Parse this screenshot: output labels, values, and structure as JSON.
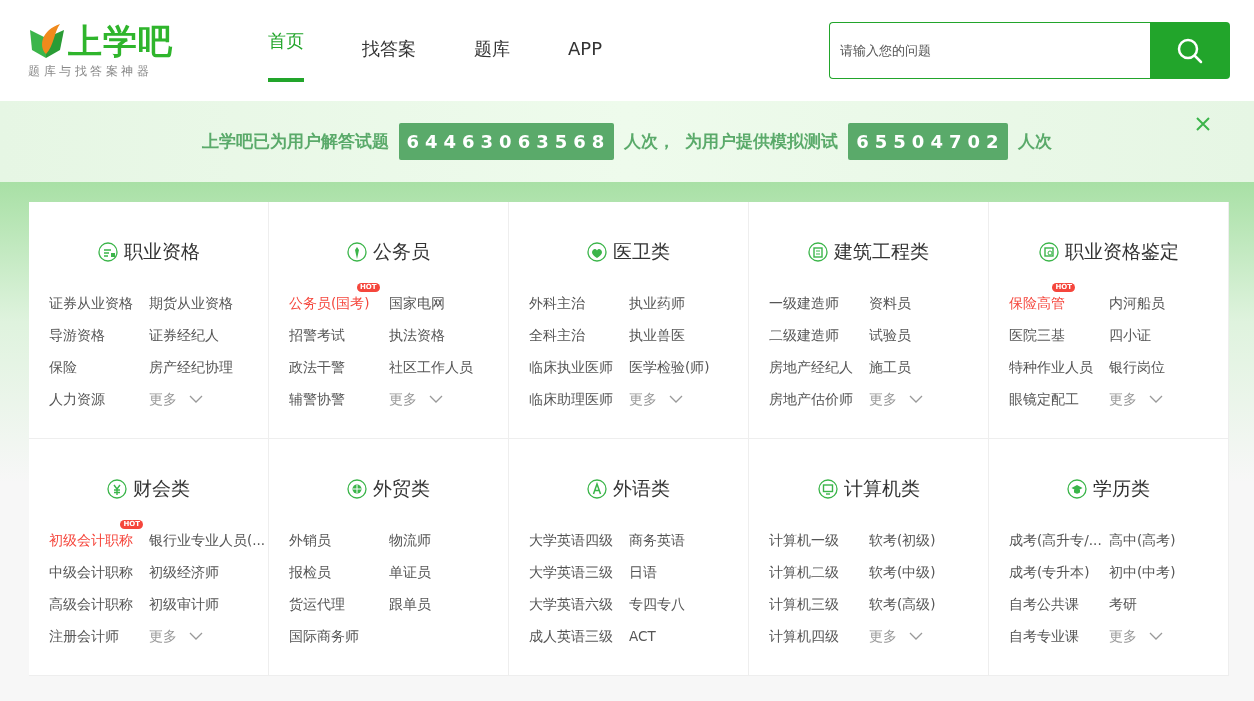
{
  "logo": {
    "name": "上学吧",
    "tagline": "题库与找答案神器"
  },
  "nav": [
    {
      "label": "首页",
      "selected": true
    },
    {
      "label": "找答案",
      "selected": false
    },
    {
      "label": "题库",
      "selected": false
    },
    {
      "label": "APP",
      "selected": false
    }
  ],
  "search": {
    "placeholder": "请输入您的问题"
  },
  "banner": {
    "parts": [
      {
        "kind": "text",
        "text": "上学吧已为用户解答试题"
      },
      {
        "kind": "counter",
        "text": "64463063568"
      },
      {
        "kind": "text",
        "text": "人次，"
      },
      {
        "kind": "text",
        "text": "为用户提供模拟测试"
      },
      {
        "kind": "counter",
        "text": "65504702"
      },
      {
        "kind": "text",
        "text": "人次"
      }
    ]
  },
  "categories": [
    {
      "title": "职业资格",
      "items": [
        {
          "text": "证券从业资格",
          "hot": false
        },
        {
          "text": "期货从业资格",
          "hot": false
        },
        {
          "text": "导游资格",
          "hot": false
        },
        {
          "text": "证券经纪人",
          "hot": false
        },
        {
          "text": "保险",
          "hot": false
        },
        {
          "text": "房产经纪协理",
          "hot": false
        },
        {
          "text": "人力资源",
          "hot": false
        }
      ],
      "more": "更多"
    },
    {
      "title": "公务员",
      "items": [
        {
          "text": "公务员(国考)",
          "hot": true,
          "badge": "HOT"
        },
        {
          "text": "国家电网",
          "hot": false
        },
        {
          "text": "招警考试",
          "hot": false
        },
        {
          "text": "执法资格",
          "hot": false
        },
        {
          "text": "政法干警",
          "hot": false
        },
        {
          "text": "社区工作人员",
          "hot": false
        },
        {
          "text": "辅警协警",
          "hot": false
        }
      ],
      "more": "更多"
    },
    {
      "title": "医卫类",
      "items": [
        {
          "text": "外科主治",
          "hot": false
        },
        {
          "text": "执业药师",
          "hot": false
        },
        {
          "text": "全科主治",
          "hot": false
        },
        {
          "text": "执业兽医",
          "hot": false
        },
        {
          "text": "临床执业医师",
          "hot": false
        },
        {
          "text": "医学检验(师)",
          "hot": false
        },
        {
          "text": "临床助理医师",
          "hot": false
        }
      ],
      "more": "更多"
    },
    {
      "title": "建筑工程类",
      "items": [
        {
          "text": "一级建造师",
          "hot": false
        },
        {
          "text": "资料员",
          "hot": false
        },
        {
          "text": "二级建造师",
          "hot": false
        },
        {
          "text": "试验员",
          "hot": false
        },
        {
          "text": "房地产经纪人",
          "hot": false
        },
        {
          "text": "施工员",
          "hot": false
        },
        {
          "text": "房地产估价师",
          "hot": false
        }
      ],
      "more": "更多"
    },
    {
      "title": "职业资格鉴定",
      "items": [
        {
          "text": "保险高管",
          "hot": true,
          "badge": "HOT"
        },
        {
          "text": "内河船员",
          "hot": false
        },
        {
          "text": "医院三基",
          "hot": false
        },
        {
          "text": "四小证",
          "hot": false
        },
        {
          "text": "特种作业人员",
          "hot": false
        },
        {
          "text": "银行岗位",
          "hot": false
        },
        {
          "text": "眼镜定配工",
          "hot": false
        }
      ],
      "more": "更多"
    },
    {
      "title": "财会类",
      "items": [
        {
          "text": "初级会计职称",
          "hot": true,
          "badge": "HOT"
        },
        {
          "text": "银行业专业人员(...",
          "hot": false
        },
        {
          "text": "中级会计职称",
          "hot": false
        },
        {
          "text": "初级经济师",
          "hot": false
        },
        {
          "text": "高级会计职称",
          "hot": false
        },
        {
          "text": "初级审计师",
          "hot": false
        },
        {
          "text": "注册会计师",
          "hot": false
        }
      ],
      "more": "更多"
    },
    {
      "title": "外贸类",
      "items": [
        {
          "text": "外销员",
          "hot": false
        },
        {
          "text": "物流师",
          "hot": false
        },
        {
          "text": "报检员",
          "hot": false
        },
        {
          "text": "单证员",
          "hot": false
        },
        {
          "text": "货运代理",
          "hot": false
        },
        {
          "text": "跟单员",
          "hot": false
        },
        {
          "text": "国际商务师",
          "hot": false
        }
      ]
    },
    {
      "title": "外语类",
      "items": [
        {
          "text": "大学英语四级",
          "hot": false
        },
        {
          "text": "商务英语",
          "hot": false
        },
        {
          "text": "大学英语三级",
          "hot": false
        },
        {
          "text": "日语",
          "hot": false
        },
        {
          "text": "大学英语六级",
          "hot": false
        },
        {
          "text": "专四专八",
          "hot": false
        },
        {
          "text": "成人英语三级",
          "hot": false
        },
        {
          "text": "ACT",
          "hot": false
        }
      ]
    },
    {
      "title": "计算机类",
      "items": [
        {
          "text": "计算机一级",
          "hot": false
        },
        {
          "text": "软考(初级)",
          "hot": false
        },
        {
          "text": "计算机二级",
          "hot": false
        },
        {
          "text": "软考(中级)",
          "hot": false
        },
        {
          "text": "计算机三级",
          "hot": false
        },
        {
          "text": "软考(高级)",
          "hot": false
        },
        {
          "text": "计算机四级",
          "hot": false
        }
      ],
      "more": "更多"
    },
    {
      "title": "学历类",
      "items": [
        {
          "text": "成考(高升专/...",
          "hot": false
        },
        {
          "text": "高中(高考)",
          "hot": false
        },
        {
          "text": "成考(专升本)",
          "hot": false
        },
        {
          "text": "初中(中考)",
          "hot": false
        },
        {
          "text": "自考公共课",
          "hot": false
        },
        {
          "text": "考研",
          "hot": false
        },
        {
          "text": "自考专业课",
          "hot": false
        }
      ],
      "more": "更多"
    }
  ]
}
